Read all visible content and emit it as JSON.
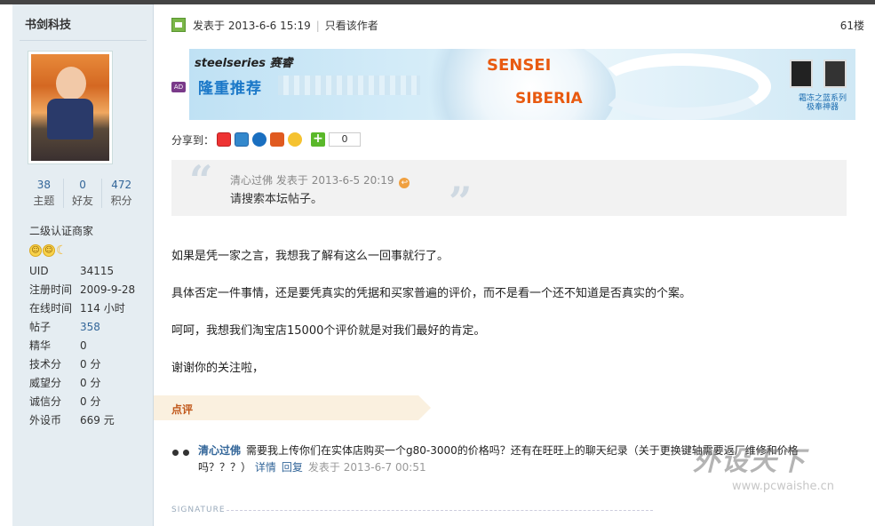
{
  "sidebar": {
    "author": "书剑科技",
    "stats": [
      {
        "value": "38",
        "label": "主题"
      },
      {
        "value": "0",
        "label": "好友"
      },
      {
        "value": "472",
        "label": "积分"
      }
    ],
    "rank": "二级认证商家",
    "info": [
      {
        "key": "UID",
        "value": "34115",
        "link": false
      },
      {
        "key": "注册时间",
        "value": "2009-9-28",
        "link": false
      },
      {
        "key": "在线时间",
        "value": "114 小时",
        "link": false
      },
      {
        "key": "帖子",
        "value": "358",
        "link": true
      },
      {
        "key": "精华",
        "value": "0",
        "link": false
      },
      {
        "key": "技术分",
        "value": "0 分",
        "link": false
      },
      {
        "key": "威望分",
        "value": "0 分",
        "link": false
      },
      {
        "key": "诚信分",
        "value": "0 分",
        "link": false
      },
      {
        "key": "外设币",
        "value": "669 元",
        "link": false
      }
    ]
  },
  "post": {
    "posted_label": "发表于",
    "posted_time": "2013-6-6 15:19",
    "author_only": "只看该作者",
    "floor": "61楼"
  },
  "banner": {
    "ad_badge": "AD",
    "brand": "steelseries 赛睿",
    "promo": "隆重推荐",
    "product1": "SENSEI",
    "product2": "SIBERIA",
    "series": "霜冻之蓝系列\n极奉神器"
  },
  "share": {
    "label": "分享到：",
    "count": "0",
    "plus": "+"
  },
  "quote": {
    "author": "清心过佛",
    "posted_label": "发表于",
    "time": "2013-6-5 20:19",
    "text": "请搜索本坛帖子。"
  },
  "body": [
    "如果是凭一家之言，我想我了解有这么一回事就行了。",
    "具体否定一件事情，还是要凭真实的凭据和买家普遍的评价，而不是看一个还不知道是否真实的个案。",
    "呵呵，我想我们淘宝店15000个评价就是对我们最好的肯定。",
    "谢谢你的关注啦，"
  ],
  "comments": {
    "title": "点评",
    "items": [
      {
        "author": "清心过佛",
        "text": "需要我上传你们在实体店购买一个g80-3000的价格吗？还有在旺旺上的聊天纪录（关于更换键轴需要返厂维修和价格吗？？？）",
        "detail": "详情",
        "reply": "回复",
        "posted_label": "发表于",
        "time": "2013-6-7 00:51"
      }
    ]
  },
  "signature_label": "SIGNATURE",
  "watermark": {
    "text": "外设天下",
    "url": "www.pcwaishe.cn"
  },
  "colors": {
    "link": "#336699",
    "sidebar_bg": "#e5edf2",
    "comment_bar": "#faf0df",
    "comment_title": "#c0571a"
  }
}
